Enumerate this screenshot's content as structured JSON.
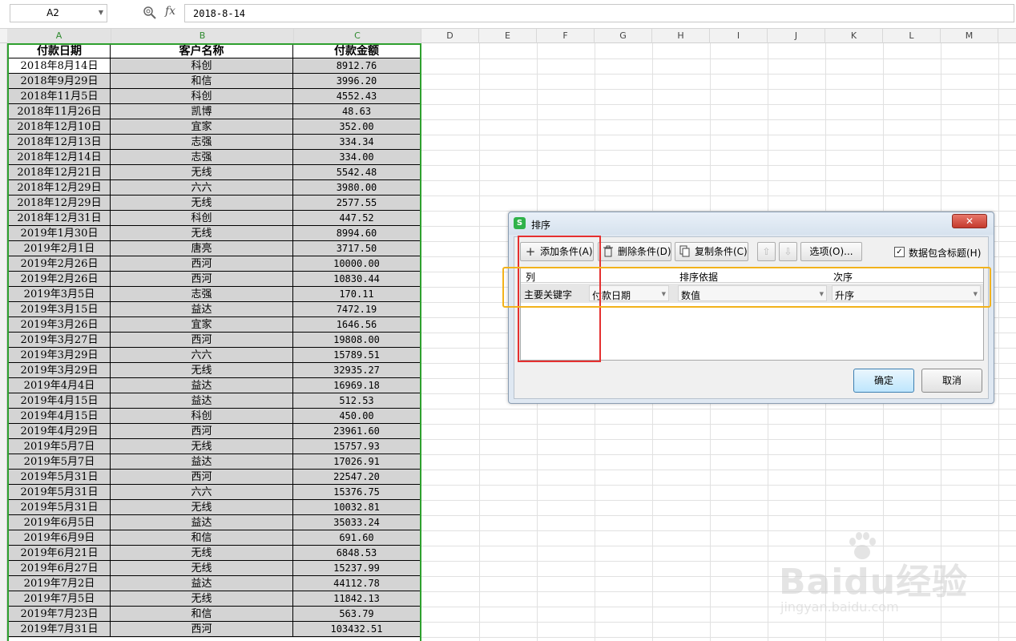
{
  "formula_bar": {
    "name_box": "A2",
    "fx_label": "fx",
    "formula_value": "2018-8-14"
  },
  "columns": [
    "A",
    "B",
    "C",
    "D",
    "E",
    "F",
    "G",
    "H",
    "I",
    "J",
    "K",
    "L",
    "M"
  ],
  "table": {
    "headers": [
      "付款日期",
      "客户名称",
      "付款金额"
    ],
    "rows": [
      [
        "2018年8月14日",
        "科创",
        "8912.76"
      ],
      [
        "2018年9月29日",
        "和信",
        "3996.20"
      ],
      [
        "2018年11月5日",
        "科创",
        "4552.43"
      ],
      [
        "2018年11月26日",
        "凯博",
        "48.63"
      ],
      [
        "2018年12月10日",
        "宜家",
        "352.00"
      ],
      [
        "2018年12月13日",
        "志强",
        "334.34"
      ],
      [
        "2018年12月14日",
        "志强",
        "334.00"
      ],
      [
        "2018年12月21日",
        "无线",
        "5542.48"
      ],
      [
        "2018年12月29日",
        "六六",
        "3980.00"
      ],
      [
        "2018年12月29日",
        "无线",
        "2577.55"
      ],
      [
        "2018年12月31日",
        "科创",
        "447.52"
      ],
      [
        "2019年1月30日",
        "无线",
        "8994.60"
      ],
      [
        "2019年2月1日",
        "唐亮",
        "3717.50"
      ],
      [
        "2019年2月26日",
        "西河",
        "10000.00"
      ],
      [
        "2019年2月26日",
        "西河",
        "10830.44"
      ],
      [
        "2019年3月5日",
        "志强",
        "170.11"
      ],
      [
        "2019年3月15日",
        "益达",
        "7472.19"
      ],
      [
        "2019年3月26日",
        "宜家",
        "1646.56"
      ],
      [
        "2019年3月27日",
        "西河",
        "19808.00"
      ],
      [
        "2019年3月29日",
        "六六",
        "15789.51"
      ],
      [
        "2019年3月29日",
        "无线",
        "32935.27"
      ],
      [
        "2019年4月4日",
        "益达",
        "16969.18"
      ],
      [
        "2019年4月15日",
        "益达",
        "512.53"
      ],
      [
        "2019年4月15日",
        "科创",
        "450.00"
      ],
      [
        "2019年4月29日",
        "西河",
        "23961.60"
      ],
      [
        "2019年5月7日",
        "无线",
        "15757.93"
      ],
      [
        "2019年5月7日",
        "益达",
        "17026.91"
      ],
      [
        "2019年5月31日",
        "西河",
        "22547.20"
      ],
      [
        "2019年5月31日",
        "六六",
        "15376.75"
      ],
      [
        "2019年5月31日",
        "无线",
        "10032.81"
      ],
      [
        "2019年6月5日",
        "益达",
        "35033.24"
      ],
      [
        "2019年6月9日",
        "和信",
        "691.60"
      ],
      [
        "2019年6月21日",
        "无线",
        "6848.53"
      ],
      [
        "2019年6月27日",
        "无线",
        "15237.99"
      ],
      [
        "2019年7月2日",
        "益达",
        "44112.78"
      ],
      [
        "2019年7月5日",
        "无线",
        "11842.13"
      ],
      [
        "2019年7月23日",
        "和信",
        "563.79"
      ],
      [
        "2019年7月31日",
        "西河",
        "103432.51"
      ]
    ]
  },
  "dialog": {
    "title": "排序",
    "logo": "S",
    "close": "✕",
    "toolbar": {
      "add": "添加条件(A)",
      "delete": "删除条件(D)",
      "copy": "复制条件(C)",
      "up": "⇧",
      "down": "⇩",
      "options": "选项(O)...",
      "has_header_label": "数据包含标题(H)",
      "has_header_checked": "✓"
    },
    "list": {
      "col_header": "列",
      "basis_header": "排序依据",
      "order_header": "次序",
      "row_label": "主要关键字",
      "column_value": "付款日期",
      "basis_value": "数值",
      "order_value": "升序"
    },
    "ok": "确定",
    "cancel": "取消"
  },
  "watermark": {
    "text": "Baidu经验",
    "sub": "jingyan.baidu.com"
  },
  "colors": {
    "selection_green": "#2ea02e",
    "highlight_red": "#e53030",
    "highlight_yellow": "#f2b21b"
  }
}
